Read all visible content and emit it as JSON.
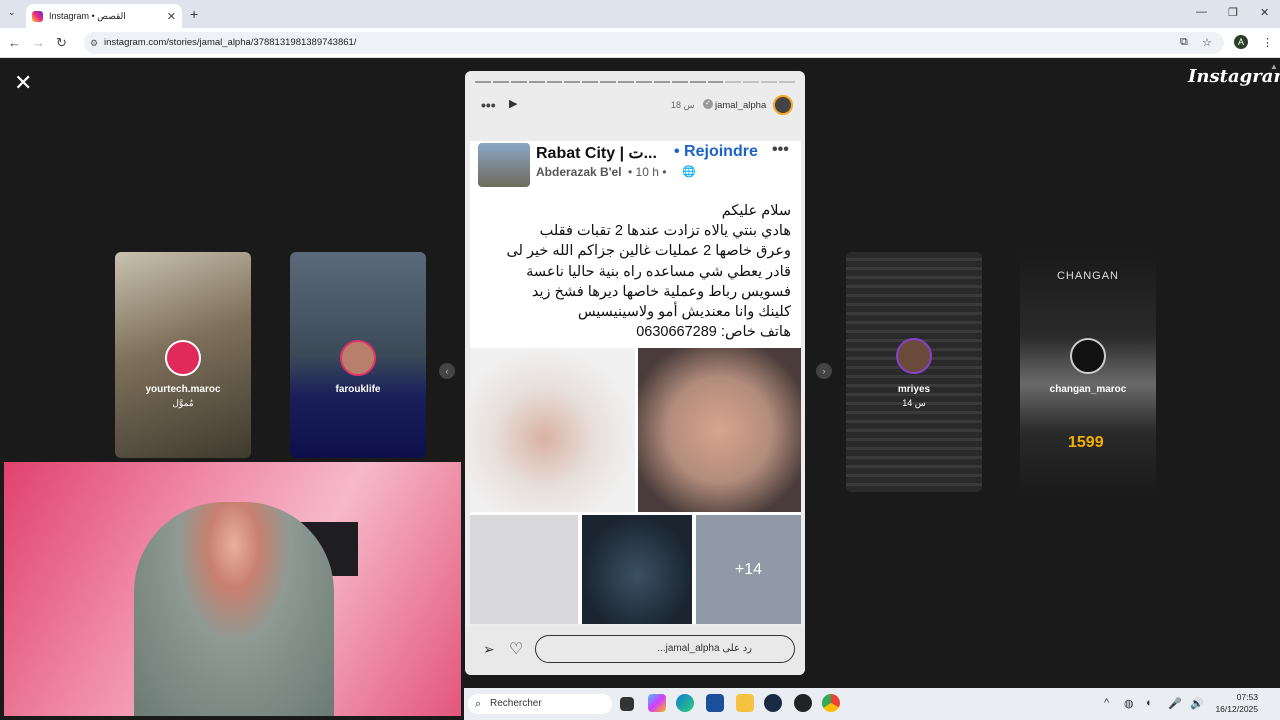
{
  "browser": {
    "tab_title": "Instagram • القصص",
    "new_tab": "+",
    "url": "instagram.com/stories/jamal_alpha/3788131981389743861/",
    "profile_initial": "A"
  },
  "viewer": {
    "logo": "Instagram",
    "close_label": "✕"
  },
  "left_stories": [
    {
      "username": "yourtech.maroc",
      "time": "مُموَّل"
    },
    {
      "username": "farouklife",
      "time": ""
    }
  ],
  "right_stories": [
    {
      "username": "mriyes",
      "time": "14 س"
    },
    {
      "username": "changan_maroc",
      "time": "",
      "brand": "CHANGAN"
    }
  ],
  "story": {
    "username": "jamal_alpha",
    "time": "18 س",
    "post": {
      "group_name": "Rabat City | ت...",
      "join_label": "• Rejoindre",
      "author": "Abderazak B'el",
      "post_time": "• 10 h •",
      "text_lines": [
        "سلام عليكم",
        "هادي بنتي يالاه تزادت عندها 2 تقبات فقلب",
        "وعرق خاصها 2 عمليات غالين جزاكم الله خير لى",
        "قادر يعطي شي مساعده راه بنية حاليا ناعسة",
        "فسويس رباط وعملية خاصها ديرها فشخ زيد",
        "كلينك وانا معنديش أمو ولاسينيسيس",
        "هاتف خاص: 0630667289"
      ],
      "more_photos": "+14"
    },
    "reply_placeholder": "رد على jamal_alpha..."
  },
  "taskbar": {
    "search_placeholder": "Rechercher",
    "time": "07:53",
    "date": "16/12/2025"
  }
}
